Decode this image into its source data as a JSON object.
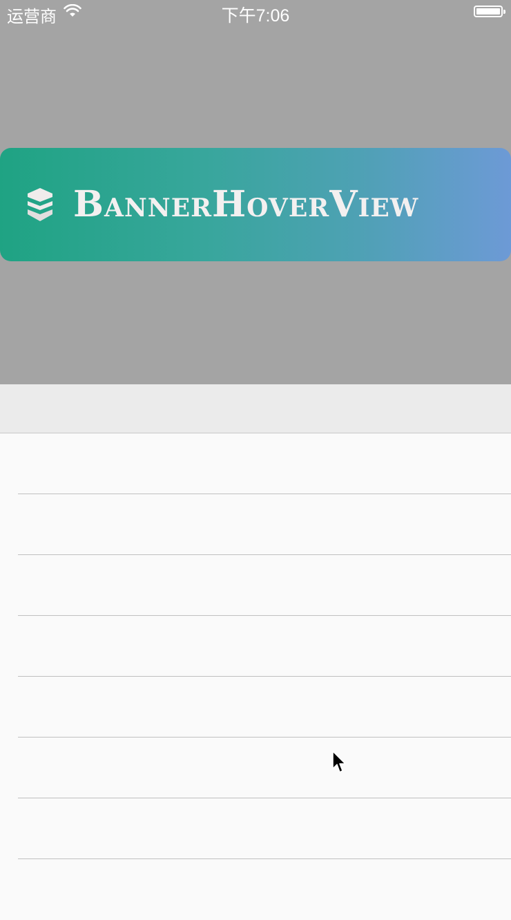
{
  "status_bar": {
    "carrier": "运营商",
    "time": "下午7:06",
    "icons": [
      "wifi-icon",
      "battery-icon"
    ]
  },
  "banner": {
    "title": "BannerHoverView",
    "icon": "stack-layers-icon",
    "gradient": [
      "#1fa383",
      "#6d9ad6"
    ]
  },
  "section_header": {
    "label": ""
  },
  "table": {
    "rows": [
      "",
      "",
      "",
      "",
      "",
      "",
      "",
      ""
    ]
  },
  "colors": {
    "header_bg": "#a4a4a4",
    "list_bg": "#fafafa",
    "separator": "#bfbfbf"
  }
}
